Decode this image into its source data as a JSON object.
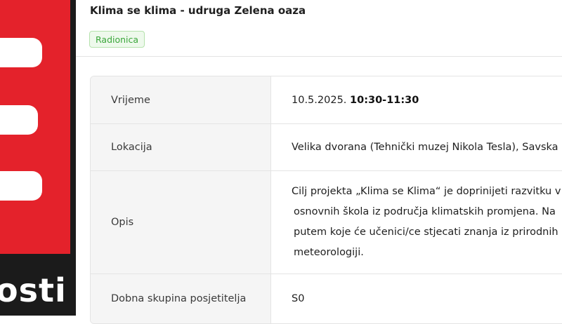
{
  "sidebar": {
    "logo_text": "osti",
    "colors": {
      "brand_red": "#e4222b",
      "background": "#1b1b1b"
    }
  },
  "event": {
    "title": "Klima se klima - udruga Zelena oaza",
    "tag": "Radionica",
    "tag_color": "#3aa63a"
  },
  "details": {
    "time": {
      "label": "Vrijeme",
      "date": "10.5.2025.",
      "hours": "10:30-11:30"
    },
    "location": {
      "label": "Lokacija",
      "value": "Velika dvorana (Tehnički muzej Nikola Tesla), Savska"
    },
    "description": {
      "label": "Opis",
      "lines": [
        "Cilj projekta „Klima se Klima“ je doprinijeti razvitku v",
        "osnovnih škola iz područja klimatskih promjena. Na",
        "putem koje će učenici/ce stjecati znanja iz prirodnih",
        "meteorologiji."
      ]
    },
    "age_group": {
      "label": "Dobna skupina posjetitelja",
      "value": "S0"
    }
  }
}
